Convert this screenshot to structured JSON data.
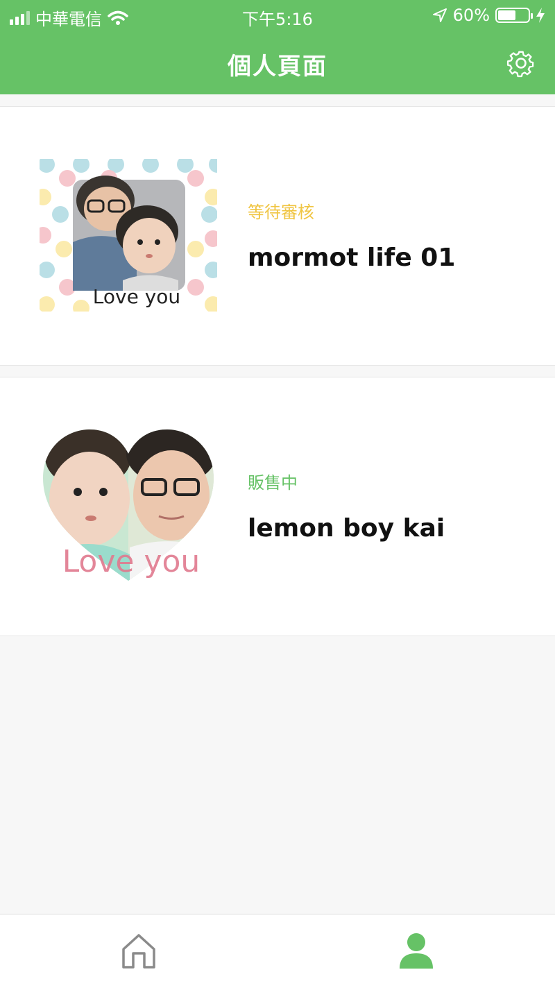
{
  "status_bar": {
    "carrier": "中華電信",
    "time": "下午5:16",
    "battery_percent": "60%",
    "battery_level": 0.6
  },
  "header": {
    "title": "個人頁面",
    "settings_icon": "gear-icon"
  },
  "colors": {
    "brand_green": "#66c266",
    "pending_yellow": "#f0c542",
    "selling_green": "#66c266"
  },
  "products": [
    {
      "status": "等待審核",
      "status_color": "#f0c542",
      "name": "mormot  life  01",
      "image_caption": "Love you"
    },
    {
      "status": "販售中",
      "status_color": "#66c266",
      "name": "lemon boy kai",
      "image_caption": "Love you"
    }
  ],
  "tabbar": {
    "items": [
      {
        "icon": "home-icon",
        "active": false
      },
      {
        "icon": "person-icon",
        "active": true
      }
    ]
  }
}
